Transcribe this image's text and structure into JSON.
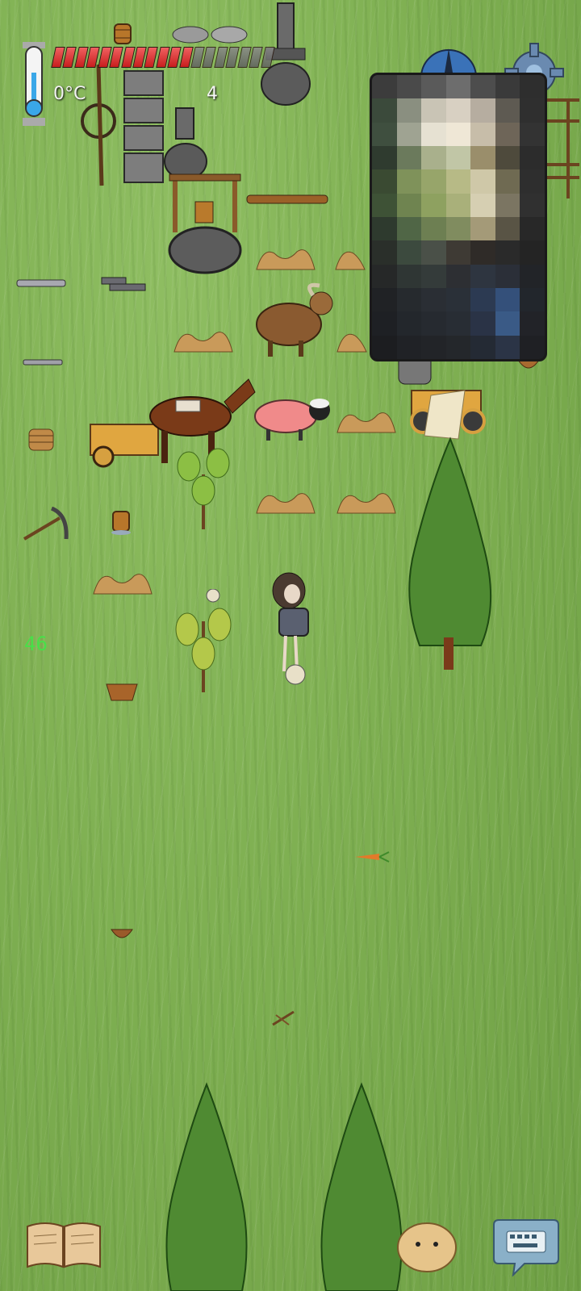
{
  "hud": {
    "temperature": "0°C",
    "age": "4",
    "food": {
      "filled": 12,
      "total": 19
    }
  },
  "debug": {
    "fps": "46"
  },
  "icons": {
    "temperature": "thermometer-icon",
    "compass": "compass-icon",
    "settings": "gear-icon",
    "tech_tree": "book-icon",
    "emote": "potato-face-icon",
    "chat": "keyboard-icon"
  },
  "colors": {
    "food_full": "#d82828",
    "food_empty": "#777777",
    "grass": "#7fb052",
    "debug_text": "#48e048"
  },
  "overlay": {
    "pixels": [
      "#3c3c3c",
      "#4a4a4a",
      "#5a5a5a",
      "#6d6d6d",
      "#4d4d4d",
      "#3a3a3a",
      "#2e2e2e",
      "#3b4a3b",
      "#8a8f80",
      "#c9c4b5",
      "#d8d0c2",
      "#b6ada0",
      "#5e5a52",
      "#2f2f2f",
      "#3f4f3f",
      "#9fa392",
      "#e6e1d2",
      "#efe7d6",
      "#c7bda9",
      "#6e6558",
      "#333333",
      "#2f3b2f",
      "#6b7a5c",
      "#a9b08c",
      "#c1c6a6",
      "#9a8e6b",
      "#4e4a3c",
      "#2c2c2c",
      "#3a4a32",
      "#7f925a",
      "#97a56a",
      "#b7ba86",
      "#cfc8a8",
      "#6f6a52",
      "#2e2e2e",
      "#3e5236",
      "#6f8450",
      "#8ea160",
      "#a9b07a",
      "#d6cfb2",
      "#7b7562",
      "#303030",
      "#2e3a2e",
      "#506646",
      "#6d7f52",
      "#808c5f",
      "#a49a78",
      "#595445",
      "#282828",
      "#2a2f2a",
      "#3c4a3e",
      "#4a5048",
      "#3e3a34",
      "#2f2b28",
      "#2a2a2a",
      "#242424",
      "#262828",
      "#2f3634",
      "#343b3a",
      "#2d2f33",
      "#2e3540",
      "#2b2f38",
      "#222428",
      "#202225",
      "#262a2e",
      "#2a2e34",
      "#2a3038",
      "#2c3a52",
      "#34507a",
      "#22262c",
      "#1e2024",
      "#23272c",
      "#262a30",
      "#282d34",
      "#2a3346",
      "#3a5a86",
      "#222328",
      "#1c1d20",
      "#202226",
      "#222428",
      "#24272b",
      "#242a34",
      "#2b3446",
      "#1f2024"
    ]
  }
}
